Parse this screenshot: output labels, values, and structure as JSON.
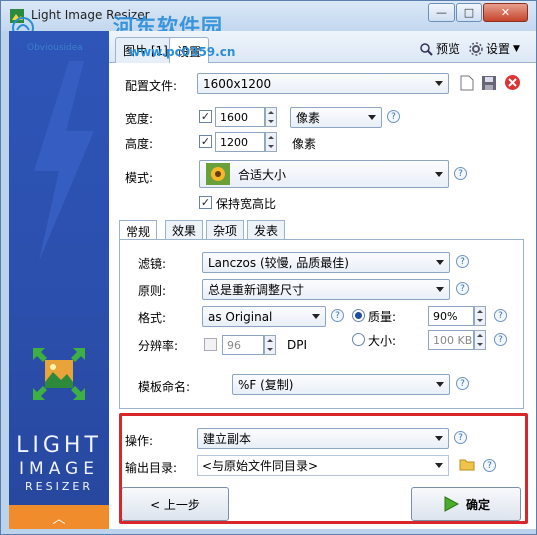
{
  "window": {
    "title": "Light Image Resizer",
    "minimize": "—",
    "maximize": "□",
    "close": "✕"
  },
  "watermark": {
    "text": "河东软件园",
    "url": "www.pc0359.cn",
    "brand": "Obviousidea"
  },
  "sidebar": {
    "brand_line1": "LIGHT",
    "brand_line2": "IMAGE",
    "brand_line3": "RESIZER",
    "collapse_glyph": "︿"
  },
  "tabs": [
    {
      "label": "图片 [1]"
    },
    {
      "label": "设置"
    }
  ],
  "header_links": {
    "preview": "预览",
    "settings": "设置"
  },
  "config": {
    "label": "配置文件:",
    "value": "1600x1200"
  },
  "width": {
    "label": "宽度:",
    "value": "1600",
    "unit": "像素"
  },
  "height": {
    "label": "高度:",
    "value": "1200",
    "unit": "像素"
  },
  "mode": {
    "label": "模式:",
    "value": "合适大小"
  },
  "keep_ratio": {
    "label": "保持宽高比"
  },
  "subtabs": [
    {
      "label": "常规"
    },
    {
      "label": "效果"
    },
    {
      "label": "杂项"
    },
    {
      "label": "发表"
    }
  ],
  "general": {
    "filter": {
      "label": "滤镜:",
      "value": "Lanczos (较慢, 品质最佳)"
    },
    "principle": {
      "label": "原则:",
      "value": "总是重新调整尺寸"
    },
    "format": {
      "label": "格式:",
      "value": "as Original"
    },
    "quality": {
      "label": "质量:",
      "value": "90%"
    },
    "size": {
      "label": "大小:",
      "value": "100 KB"
    },
    "resolution": {
      "label": "分辨率:",
      "value": "96",
      "unit": "DPI"
    },
    "template": {
      "label": "模板命名:",
      "value": "%F (复制)"
    }
  },
  "operation": {
    "label": "操作:",
    "value": "建立副本"
  },
  "output": {
    "label": "输出目录:",
    "value": "<与原始文件同目录>"
  },
  "buttons": {
    "back": "< 上一步",
    "ok": "确定"
  },
  "colors": {
    "sidebar": "#2b4fac",
    "accent": "#f08c2c",
    "highlight": "#d9262b"
  }
}
